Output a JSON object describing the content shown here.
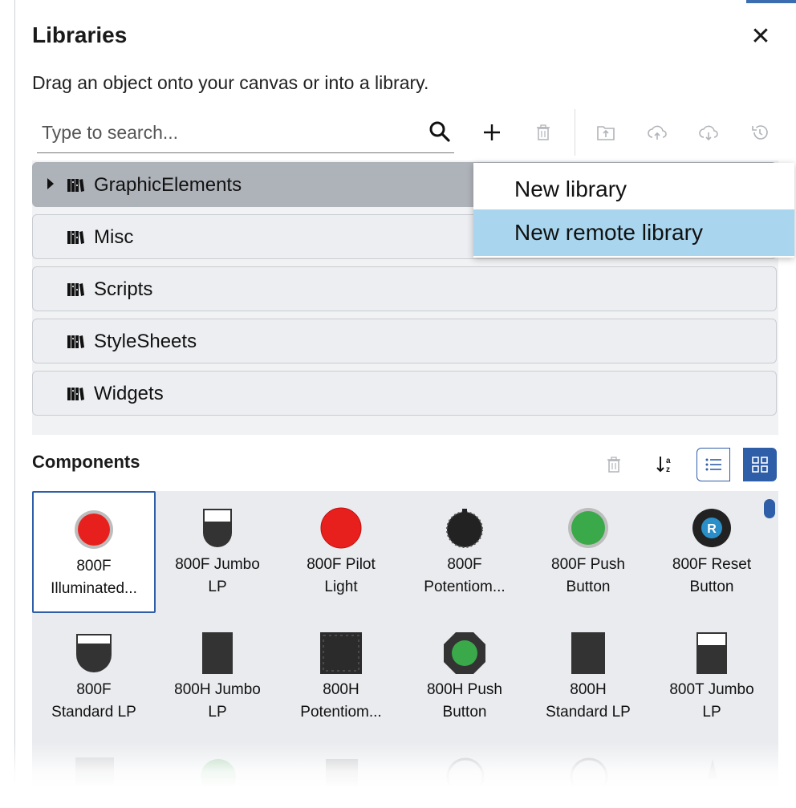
{
  "panel": {
    "title": "Libraries",
    "subtitle": "Drag an object onto your canvas or into a library.",
    "close_icon": "close-icon"
  },
  "search": {
    "placeholder": "Type to search...",
    "icon": "search-icon"
  },
  "toolbar": {
    "buttons": [
      "add-icon",
      "trash-icon",
      "import-icon",
      "upload-cloud-icon",
      "download-cloud-icon",
      "history-icon"
    ]
  },
  "libraries": [
    {
      "label": "GraphicElements",
      "expanded_caret": true,
      "active": true
    },
    {
      "label": "Misc"
    },
    {
      "label": "Scripts"
    },
    {
      "label": "StyleSheets"
    },
    {
      "label": "Widgets"
    }
  ],
  "context_menu": {
    "items": [
      {
        "label": "New library",
        "highlighted": false
      },
      {
        "label": "New remote library",
        "highlighted": true
      }
    ]
  },
  "components": {
    "title": "Components",
    "toolbar": [
      "trash-icon",
      "sort-az-icon",
      "list-view-icon",
      "grid-view-icon"
    ],
    "items": [
      {
        "line1": "800F",
        "line2": "Illuminated...",
        "icon": "red-illuminated-button",
        "selected": true
      },
      {
        "line1": "800F Jumbo",
        "line2": "LP",
        "icon": "jumbo-lp"
      },
      {
        "line1": "800F Pilot",
        "line2": "Light",
        "icon": "red-pilot-light"
      },
      {
        "line1": "800F",
        "line2": "Potentiom...",
        "icon": "potentiometer"
      },
      {
        "line1": "800F Push",
        "line2": "Button",
        "icon": "green-push-button"
      },
      {
        "line1": "800F Reset",
        "line2": "Button",
        "icon": "reset-button"
      },
      {
        "line1": "800F",
        "line2": "Standard LP",
        "icon": "standard-lp"
      },
      {
        "line1": "800H Jumbo",
        "line2": "LP",
        "icon": "dark-rect"
      },
      {
        "line1": "800H",
        "line2": "Potentiom...",
        "icon": "square-potentiometer"
      },
      {
        "line1": "800H Push",
        "line2": "Button",
        "icon": "octagon-green-button"
      },
      {
        "line1": "800H",
        "line2": "Standard LP",
        "icon": "dark-rect"
      },
      {
        "line1": "800T Jumbo",
        "line2": "LP",
        "icon": "jumbo-lp-square"
      }
    ],
    "reset_glyph": "R"
  },
  "colors": {
    "accent": "#2e5ea8",
    "menu_highlight": "#a9d6ee",
    "active_library": "#aeb2b9",
    "red": "#e8201d",
    "green": "#3aa94a",
    "dark": "#333333"
  }
}
